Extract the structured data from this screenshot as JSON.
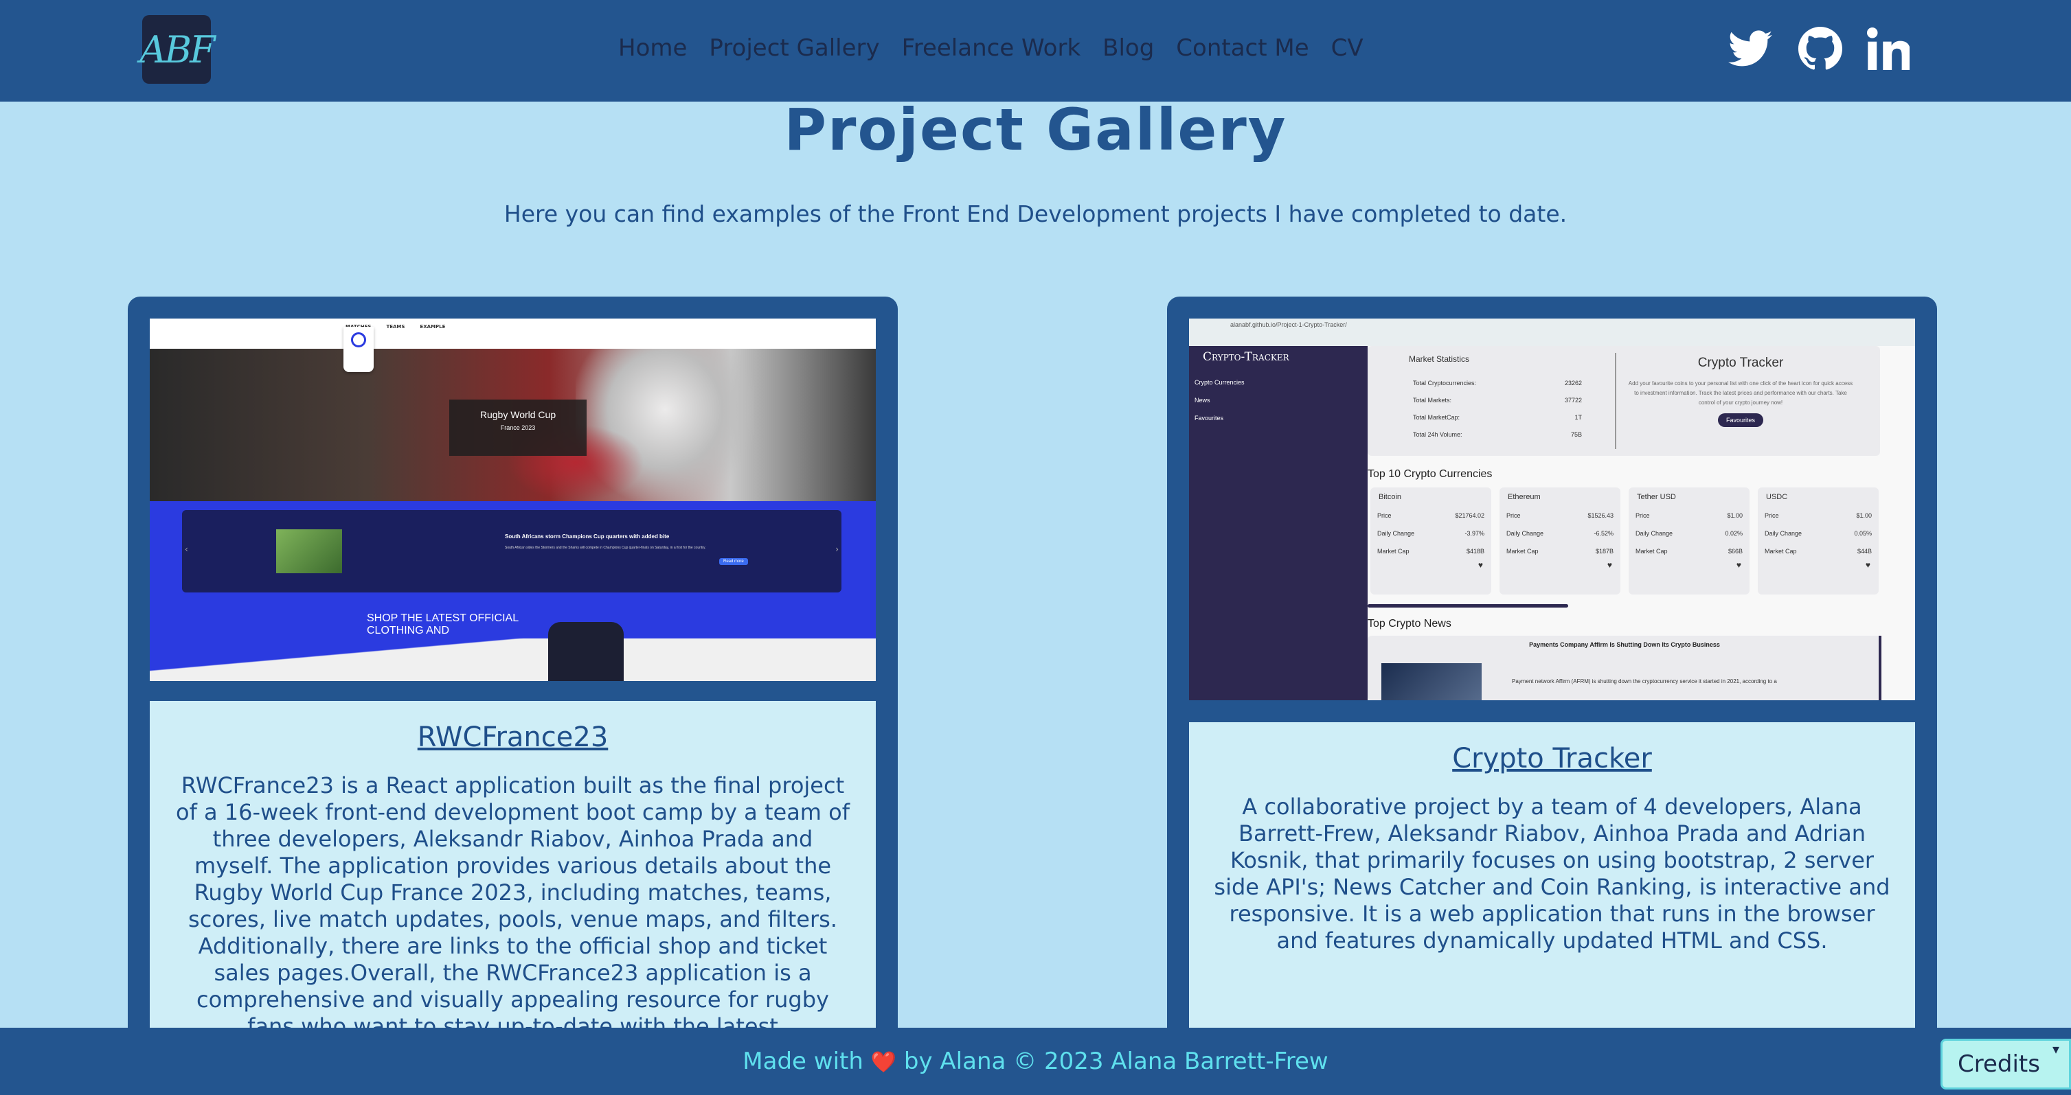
{
  "nav": {
    "logo": "ABF",
    "links": [
      "Home",
      "Project Gallery",
      "Freelance Work",
      "Blog",
      "Contact Me",
      "CV"
    ],
    "social": [
      "twitter-icon",
      "github-icon",
      "linkedin-icon"
    ]
  },
  "main": {
    "title": "Project Gallery",
    "subtitle": "Here you can find examples of the Front End Development projects I have completed to date."
  },
  "projects": [
    {
      "title": "RWCFrance23",
      "description": "RWCFrance23 is a React application built as the final project of a 16-week front-end development boot camp by a team of three developers, Aleksandr Riabov, Ainhoa Prada and myself. The application provides various details about the Rugby World Cup France 2023, including matches, teams, scores, live match updates, pools, venue maps, and filters. Additionally, there are links to the official shop and ticket sales pages.Overall, the RWCFrance23 application is a comprehensive and visually appealing resource for rugby fans who want to stay up-to-date with the latest",
      "screenshot": {
        "nav": [
          "MATCHES",
          "TEAMS",
          "EXAMPLE"
        ],
        "banner_title": "Rugby World Cup",
        "banner_sub": "France 2023",
        "slide_title": "South Africans storm Champions Cup quarters with added bite",
        "slide_text": "South African sides the Stormers and the Sharks will compete in Champions Cup quarter-finals on Saturday, in a first for the country.",
        "slide_button": "Read more",
        "shop_text_1": "SHOP THE LATEST OFFICIAL",
        "shop_text_2": "CLOTHING AND"
      }
    },
    {
      "title": "Crypto Tracker",
      "description": "A collaborative project by a team of 4 developers, Alana Barrett-Frew, Aleksandr Riabov, Ainhoa Prada and Adrian Kosnik, that primarily focuses on using bootstrap, 2 server side API's; News Catcher and Coin Ranking, is interactive and responsive. It is a web application that runs in the browser and features dynamically updated HTML and CSS.",
      "screenshot": {
        "url": "alanabf.github.io/Project-1-Crypto-Tracker/",
        "brand": "Crypto-Tracker",
        "side_links": [
          "Crypto Currencies",
          "News",
          "Favourites"
        ],
        "stats_title": "Market Statistics",
        "stats": [
          {
            "label": "Total Cryptocurrencies:",
            "value": "23262"
          },
          {
            "label": "Total Markets:",
            "value": "37722"
          },
          {
            "label": "Total MarketCap:",
            "value": "1T"
          },
          {
            "label": "Total 24h Volume:",
            "value": "75B"
          }
        ],
        "hero_title": "Crypto Tracker",
        "hero_text": "Add your favourite coins to your personal list with one click of the heart icon for quick access to investment information. Track the latest prices and performance with our charts. Take control of your crypto journey now!",
        "hero_button": "Favourites",
        "top10_title": "Top 10 Crypto Currencies",
        "coins": [
          {
            "name": "Bitcoin",
            "price": "$21764.02",
            "change": "-3.97%",
            "cap": "$418B"
          },
          {
            "name": "Ethereum",
            "price": "$1526.43",
            "change": "-6.52%",
            "cap": "$187B"
          },
          {
            "name": "Tether USD",
            "price": "$1.00",
            "change": "0.02%",
            "cap": "$66B"
          },
          {
            "name": "USDC",
            "price": "$1.00",
            "change": "0.05%",
            "cap": "$44B"
          }
        ],
        "coin_labels": {
          "price": "Price",
          "change": "Daily Change",
          "cap": "Market Cap"
        },
        "news_title": "Top Crypto News",
        "news_headline": "Payments Company Affirm Is Shutting Down Its Crypto Business",
        "news_text": "Payment network Affirm (AFRM) is shutting down the cryptocurrency service it started in 2021, according to a"
      }
    }
  ],
  "footer": {
    "made_with": "Made with",
    "heart": "❤️",
    "credit": "by Alana © 2023 Alana Barrett-Frew"
  },
  "credits_label": "Credits",
  "colors": {
    "navbar": "#23558f",
    "background": "#b6e0f4",
    "card_text_bg": "#cfeef7",
    "footer_text": "#5fe0ee"
  }
}
